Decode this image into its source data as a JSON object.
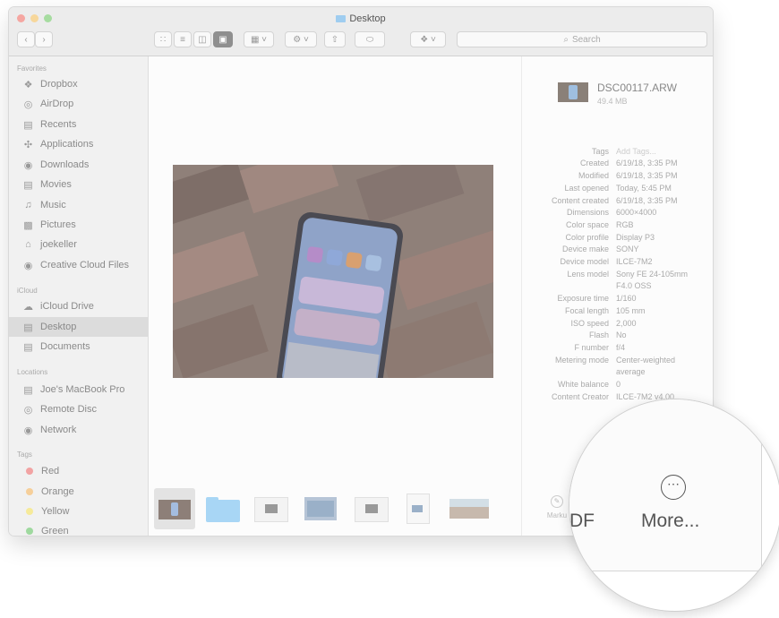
{
  "window": {
    "title": "Desktop"
  },
  "toolbar": {
    "search_placeholder": "Search",
    "view_buttons": [
      "icon-view-icon",
      "list-view-icon",
      "column-view-icon",
      "gallery-view-icon"
    ],
    "group_label": "group-icon",
    "action_label": "gear-icon",
    "share_label": "share-icon",
    "tag_label": "tag-icon",
    "dropbox_label": "dropbox-icon"
  },
  "sidebar": {
    "favorites_header": "Favorites",
    "favorites": [
      {
        "label": "Dropbox",
        "icon": "dropbox-icon"
      },
      {
        "label": "AirDrop",
        "icon": "airdrop-icon"
      },
      {
        "label": "Recents",
        "icon": "recents-icon"
      },
      {
        "label": "Applications",
        "icon": "applications-icon"
      },
      {
        "label": "Downloads",
        "icon": "downloads-icon"
      },
      {
        "label": "Movies",
        "icon": "movies-icon"
      },
      {
        "label": "Music",
        "icon": "music-icon"
      },
      {
        "label": "Pictures",
        "icon": "pictures-icon"
      },
      {
        "label": "joekeller",
        "icon": "home-icon"
      },
      {
        "label": "Creative Cloud Files",
        "icon": "creative-cloud-icon"
      }
    ],
    "icloud_header": "iCloud",
    "icloud": [
      {
        "label": "iCloud Drive",
        "icon": "cloud-icon"
      },
      {
        "label": "Desktop",
        "icon": "desktop-icon",
        "selected": true
      },
      {
        "label": "Documents",
        "icon": "documents-icon"
      }
    ],
    "locations_header": "Locations",
    "locations": [
      {
        "label": "Joe's MacBook Pro",
        "icon": "laptop-icon"
      },
      {
        "label": "Remote Disc",
        "icon": "disc-icon"
      },
      {
        "label": "Network",
        "icon": "network-icon"
      }
    ],
    "tags_header": "Tags",
    "tags": [
      {
        "label": "Red",
        "color": "#f2a3a3"
      },
      {
        "label": "Orange",
        "color": "#f6cf9a"
      },
      {
        "label": "Yellow",
        "color": "#f6ea9a"
      },
      {
        "label": "Green",
        "color": "#9fd99f"
      }
    ]
  },
  "file": {
    "name": "DSC00117.ARW",
    "size": "49.4 MB"
  },
  "metadata": [
    {
      "key": "Tags",
      "value": "Add Tags..."
    },
    {
      "key": "Created",
      "value": "6/19/18, 3:35 PM"
    },
    {
      "key": "Modified",
      "value": "6/19/18, 3:35 PM"
    },
    {
      "key": "Last opened",
      "value": "Today, 5:45 PM"
    },
    {
      "key": "Content created",
      "value": "6/19/18, 3:35 PM"
    },
    {
      "key": "Dimensions",
      "value": "6000×4000"
    },
    {
      "key": "Color space",
      "value": "RGB"
    },
    {
      "key": "Color profile",
      "value": "Display P3"
    },
    {
      "key": "Device make",
      "value": "SONY"
    },
    {
      "key": "Device model",
      "value": "ILCE-7M2"
    },
    {
      "key": "Lens model",
      "value": "Sony FE 24-105mm",
      "value2": "F4.0 OSS"
    },
    {
      "key": "Exposure time",
      "value": "1/160"
    },
    {
      "key": "Focal length",
      "value": "105 mm"
    },
    {
      "key": "ISO speed",
      "value": "2,000"
    },
    {
      "key": "Flash",
      "value": "No"
    },
    {
      "key": "F number",
      "value": "f/4"
    },
    {
      "key": "Metering mode",
      "value": "Center-weighted",
      "value2": "average"
    },
    {
      "key": "White balance",
      "value": "0"
    },
    {
      "key": "Content Creator",
      "value": "ILCE-7M2 v4.00"
    }
  ],
  "quick_actions": {
    "markup_label": "Marku",
    "pdf_fragment": "DF",
    "more_label": "More..."
  }
}
